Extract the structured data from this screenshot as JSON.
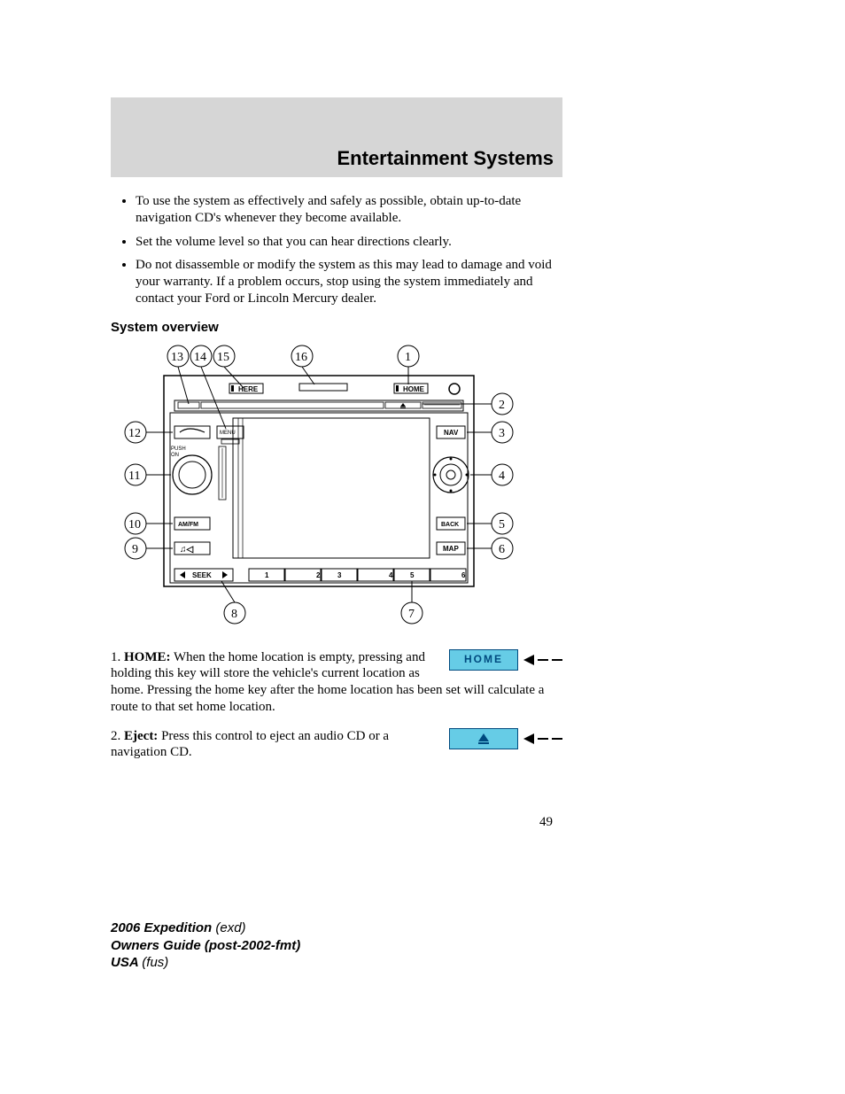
{
  "header": {
    "title": "Entertainment Systems"
  },
  "bullets": [
    "To use the system as effectively and safely as possible, obtain up-to-date navigation CD's whenever they become available.",
    "Set the volume level so that you can hear directions clearly.",
    "Do not disassemble or modify the system as this may lead to damage and void your warranty. If a problem occurs, stop using the system immediately and contact your Ford or Lincoln Mercury dealer."
  ],
  "subhead": "System overview",
  "diagram": {
    "callouts": [
      "1",
      "2",
      "3",
      "4",
      "5",
      "6",
      "7",
      "8",
      "9",
      "10",
      "11",
      "12",
      "13",
      "14",
      "15",
      "16"
    ],
    "buttons": {
      "here": "HERE",
      "home": "HOME",
      "nav": "NAV",
      "back": "BACK",
      "map": "MAP",
      "amfm": "AM/FM",
      "menu": "MENU",
      "seek": "SEEK",
      "push_on_1": "PUSH",
      "push_on_2": "ON",
      "presets": [
        "1",
        "2",
        "3",
        "4",
        "5",
        "6"
      ]
    }
  },
  "items": {
    "i1": {
      "num": "1. ",
      "label": "HOME:",
      "text1": " When the home location is empty, pressing and holding this key will store the vehicle's current location as home. Pressing the home key after the home location has been set will calculate a route to that set home location."
    },
    "i2": {
      "num": "2. ",
      "label": "Eject:",
      "text1": " Press this control to eject an audio CD or a navigation CD."
    }
  },
  "graphics": {
    "home_label": "HOME"
  },
  "page_number": "49",
  "footer": {
    "l1b": "2006 Expedition ",
    "l1i": "(exd)",
    "l2b": "Owners Guide (post-2002-fmt)",
    "l3b": "USA ",
    "l3i": "(fus)"
  }
}
